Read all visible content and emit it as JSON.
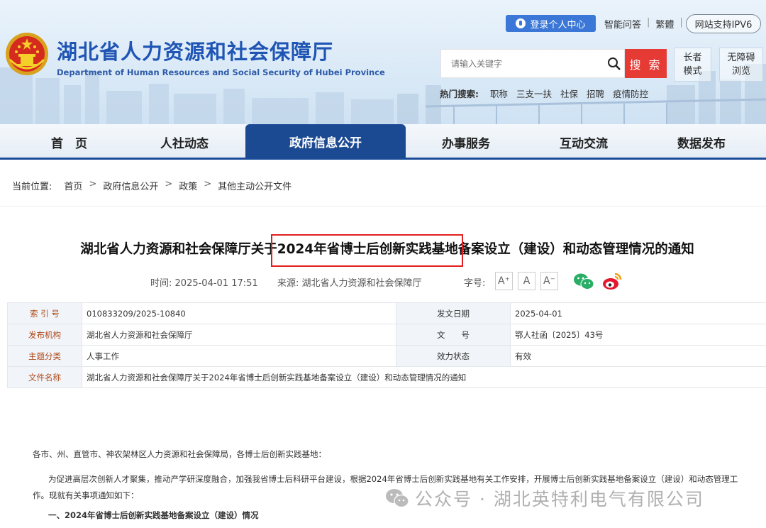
{
  "header": {
    "title": "湖北省人力资源和社会保障厅",
    "subtitle": "Department of Human Resources and Social Security of Hubei Province",
    "login_label": "登录个人中心",
    "links": [
      "智能问答",
      "繁體"
    ],
    "ipv6_label": "网站支持IPV6",
    "search_placeholder": "请输入关键字",
    "search_button": "搜 索",
    "elder_mode_lines": [
      "长者",
      "模式"
    ],
    "accessible_lines": [
      "无障碍",
      "浏览"
    ],
    "hot_label": "热门搜索:",
    "hot_terms": [
      "职称",
      "三支一扶",
      "社保",
      "招聘",
      "疫情防控"
    ]
  },
  "nav": {
    "items": [
      "首　页",
      "人社动态",
      "政府信息公开",
      "办事服务",
      "互动交流",
      "数据发布"
    ],
    "active": "政府信息公开"
  },
  "breadcrumb": {
    "label": "当前位置:",
    "items": [
      "首页",
      "政府信息公开",
      "政策",
      "其他主动公开文件"
    ]
  },
  "article": {
    "title": "湖北省人力资源和社会保障厅关于2024年省博士后创新实践基地备案设立（建设）和动态管理情况的通知",
    "time_label": "时间:",
    "time": "2025-04-01 17:51",
    "source_label": "来源:",
    "source": "湖北省人力资源和社会保障厅",
    "font_label": "字号:",
    "font_buttons": [
      "A⁺",
      "A",
      "A⁻"
    ]
  },
  "info": {
    "index_label": "索 引 号",
    "index": "010833209/2025-10840",
    "date_label": "发文日期",
    "date": "2025-04-01",
    "org_label": "发布机构",
    "org": "湖北省人力资源和社会保障厅",
    "docno_label": "文　　号",
    "docno": "鄂人社函〔2025〕43号",
    "topic_label": "主题分类",
    "topic": "人事工作",
    "status_label": "效力状态",
    "status": "有效",
    "filename_label": "文件名称",
    "filename": "湖北省人力资源和社会保障厅关于2024年省博士后创新实践基地备案设立（建设）和动态管理情况的通知"
  },
  "body": {
    "salutation": "各市、州、直管市、神农架林区人力资源和社会保障局，各博士后创新实践基地：",
    "para1": "为促进高层次创新人才聚集，推动产学研深度融合，加强我省博士后科研平台建设，根据2024年省博士后创新实践基地有关工作安排，开展博士后创新实践基地备案设立（建设）和动态管理工作。现就有关事项通知如下：",
    "heading1": "一、2024年省博士后创新实践基地备案设立（建设）情况"
  },
  "watermark": "公众号 · 湖北英特利电气有限公司",
  "colors": {
    "brand_blue": "#1f55b4",
    "nav_active": "#1c4a92",
    "search_red": "#e63a35",
    "highlight_red": "#e02020"
  }
}
